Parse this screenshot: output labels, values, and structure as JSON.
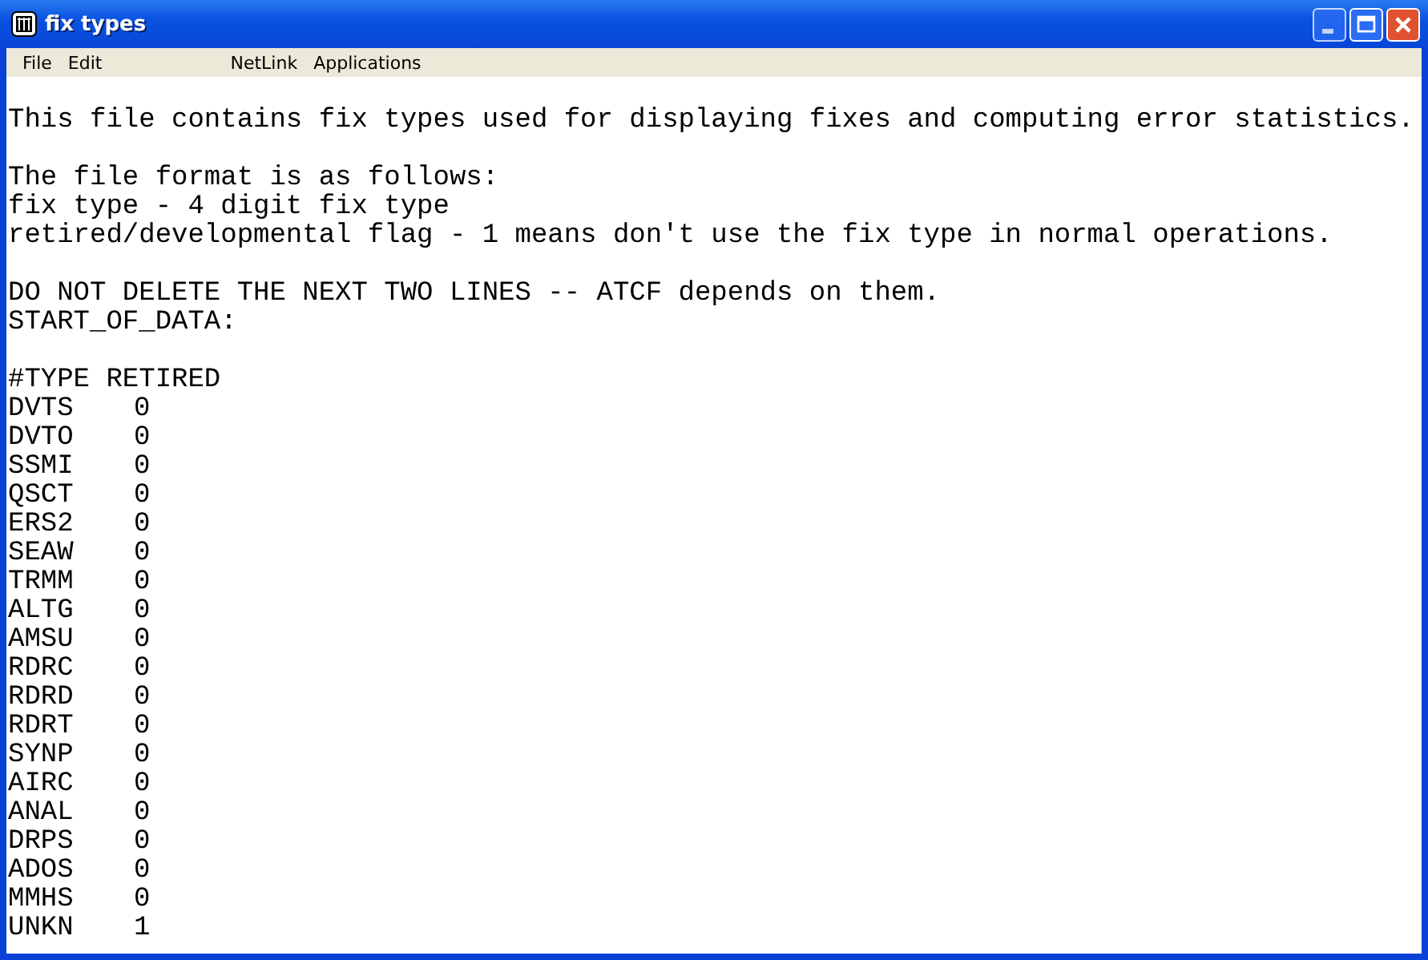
{
  "window": {
    "title": "fix types"
  },
  "menu": [
    {
      "label": "File"
    },
    {
      "label": "Edit"
    },
    {
      "label": "NetLink"
    },
    {
      "label": "Applications"
    }
  ],
  "document": {
    "paragraphs": [
      [
        "This file contains fix types used for displaying fixes and computing error statistics."
      ],
      [
        "The file format is as follows:",
        "fix type - 4 digit fix type",
        "retired/developmental flag - 1 means don't use the fix type in normal operations."
      ],
      [
        "DO NOT DELETE THE NEXT TWO LINES -- ATCF depends on them.",
        "START_OF_DATA:"
      ],
      [
        "#TYPE RETIRED"
      ]
    ],
    "rows": [
      {
        "type": "DVTS",
        "retired": "0"
      },
      {
        "type": "DVTO",
        "retired": "0"
      },
      {
        "type": "SSMI",
        "retired": "0"
      },
      {
        "type": "QSCT",
        "retired": "0"
      },
      {
        "type": "ERS2",
        "retired": "0"
      },
      {
        "type": "SEAW",
        "retired": "0"
      },
      {
        "type": "TRMM",
        "retired": "0"
      },
      {
        "type": "ALTG",
        "retired": "0"
      },
      {
        "type": "AMSU",
        "retired": "0"
      },
      {
        "type": "RDRC",
        "retired": "0"
      },
      {
        "type": "RDRD",
        "retired": "0"
      },
      {
        "type": "RDRT",
        "retired": "0"
      },
      {
        "type": "SYNP",
        "retired": "0"
      },
      {
        "type": "AIRC",
        "retired": "0"
      },
      {
        "type": "ANAL",
        "retired": "0"
      },
      {
        "type": "DRPS",
        "retired": "0"
      },
      {
        "type": "ADOS",
        "retired": "0"
      },
      {
        "type": "MMHS",
        "retired": "0"
      },
      {
        "type": "UNKN",
        "retired": "1"
      }
    ]
  }
}
